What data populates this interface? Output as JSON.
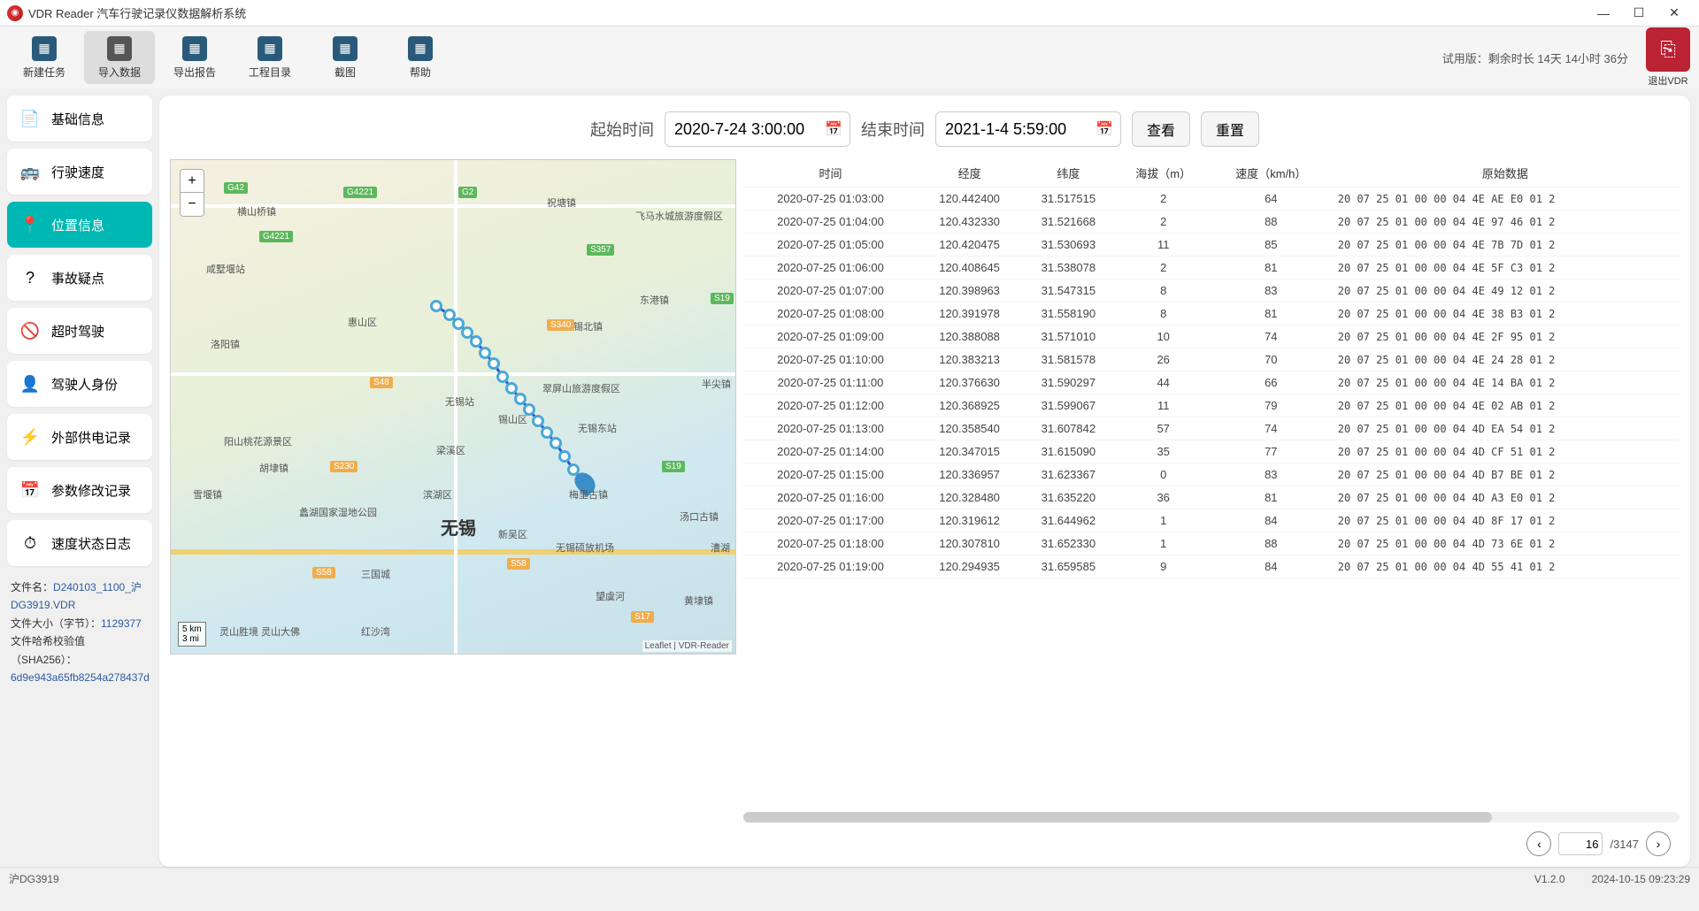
{
  "app": {
    "title": "VDR Reader 汽车行驶记录仪数据解析系统",
    "trial_text": "试用版：剩余时长 14天 14小时 36分",
    "exit_label": "退出VDR"
  },
  "toolbar": [
    {
      "id": "new-task",
      "label": "新建任务"
    },
    {
      "id": "import-data",
      "label": "导入数据",
      "active": true
    },
    {
      "id": "export-report",
      "label": "导出报告"
    },
    {
      "id": "project-dir",
      "label": "工程目录"
    },
    {
      "id": "screenshot",
      "label": "截图"
    },
    {
      "id": "help",
      "label": "帮助"
    }
  ],
  "sidebar": [
    {
      "id": "basic-info",
      "label": "基础信息",
      "icon": "📄"
    },
    {
      "id": "speed",
      "label": "行驶速度",
      "icon": "🚌"
    },
    {
      "id": "location",
      "label": "位置信息",
      "icon": "📍",
      "active": true
    },
    {
      "id": "accident",
      "label": "事故疑点",
      "icon": "?"
    },
    {
      "id": "overtime",
      "label": "超时驾驶",
      "icon": "🚫"
    },
    {
      "id": "driver",
      "label": "驾驶人身份",
      "icon": "👤"
    },
    {
      "id": "power",
      "label": "外部供电记录",
      "icon": "⚡"
    },
    {
      "id": "param",
      "label": "参数修改记录",
      "icon": "📅"
    },
    {
      "id": "speedlog",
      "label": "速度状态日志",
      "icon": "⏱"
    }
  ],
  "fileinfo": {
    "name_key": "文件名：",
    "name_val": "D240103_1100_沪DG3919.VDR",
    "size_key": "文件大小（字节）：",
    "size_val": "1129377",
    "hash_key": "文件哈希校验值（SHA256）：",
    "hash_val": "6d9e943a65fb8254a278437d"
  },
  "filter": {
    "start_label": "起始时间",
    "start_value": "2020-7-24 3:00:00",
    "end_label": "结束时间",
    "end_value": "2021-1-4 5:59:00",
    "view_btn": "查看",
    "reset_btn": "重置"
  },
  "map": {
    "city": "无锡",
    "labels": [
      "惠山区",
      "锡山区",
      "滨湖区",
      "新吴区",
      "梁溪区",
      "锡北镇",
      "东港镇",
      "祝塘镇",
      "横山桥镇",
      "咸墅堰站",
      "洛阳镇",
      "阳山桃花源景区",
      "胡埭镇",
      "雪堰镇",
      "蠡湖国家湿地公园",
      "三国城",
      "红沙湾",
      "灵山胜境 灵山大佛",
      "无锡站",
      "无锡东站",
      "无锡硕放机场",
      "翠屏山旅游度假区",
      "梅里古镇",
      "汤口古镇",
      "黄埭镇",
      "望虞河",
      "飞马水城旅游度假区",
      "半尖镇",
      "漕湖"
    ],
    "badges": [
      "G42",
      "G4221",
      "G4221",
      "G2",
      "S357",
      "S19",
      "S340",
      "S48",
      "S230",
      "S19",
      "S58",
      "S58",
      "S17"
    ],
    "scale_km": "5 km",
    "scale_mi": "3 mi",
    "attrib": "Leaflet | VDR-Reader"
  },
  "table": {
    "headers": [
      "时间",
      "经度",
      "纬度",
      "海拔（m）",
      "速度（km/h）",
      "原始数据"
    ],
    "rows": [
      [
        "2020-07-25 01:03:00",
        "120.442400",
        "31.517515",
        "2",
        "64",
        "20 07 25 01 00 00 04 4E AE E0 01 2"
      ],
      [
        "2020-07-25 01:04:00",
        "120.432330",
        "31.521668",
        "2",
        "88",
        "20 07 25 01 00 00 04 4E 97 46 01 2"
      ],
      [
        "2020-07-25 01:05:00",
        "120.420475",
        "31.530693",
        "11",
        "85",
        "20 07 25 01 00 00 04 4E 7B 7D 01 2"
      ],
      [
        "2020-07-25 01:06:00",
        "120.408645",
        "31.538078",
        "2",
        "81",
        "20 07 25 01 00 00 04 4E 5F C3 01 2"
      ],
      [
        "2020-07-25 01:07:00",
        "120.398963",
        "31.547315",
        "8",
        "83",
        "20 07 25 01 00 00 04 4E 49 12 01 2"
      ],
      [
        "2020-07-25 01:08:00",
        "120.391978",
        "31.558190",
        "8",
        "81",
        "20 07 25 01 00 00 04 4E 38 B3 01 2"
      ],
      [
        "2020-07-25 01:09:00",
        "120.388088",
        "31.571010",
        "10",
        "74",
        "20 07 25 01 00 00 04 4E 2F 95 01 2"
      ],
      [
        "2020-07-25 01:10:00",
        "120.383213",
        "31.581578",
        "26",
        "70",
        "20 07 25 01 00 00 04 4E 24 28 01 2"
      ],
      [
        "2020-07-25 01:11:00",
        "120.376630",
        "31.590297",
        "44",
        "66",
        "20 07 25 01 00 00 04 4E 14 BA 01 2"
      ],
      [
        "2020-07-25 01:12:00",
        "120.368925",
        "31.599067",
        "11",
        "79",
        "20 07 25 01 00 00 04 4E 02 AB 01 2"
      ],
      [
        "2020-07-25 01:13:00",
        "120.358540",
        "31.607842",
        "57",
        "74",
        "20 07 25 01 00 00 04 4D EA 54 01 2"
      ],
      [
        "2020-07-25 01:14:00",
        "120.347015",
        "31.615090",
        "35",
        "77",
        "20 07 25 01 00 00 04 4D CF 51 01 2"
      ],
      [
        "2020-07-25 01:15:00",
        "120.336957",
        "31.623367",
        "0",
        "83",
        "20 07 25 01 00 00 04 4D B7 BE 01 2"
      ],
      [
        "2020-07-25 01:16:00",
        "120.328480",
        "31.635220",
        "36",
        "81",
        "20 07 25 01 00 00 04 4D A3 E0 01 2"
      ],
      [
        "2020-07-25 01:17:00",
        "120.319612",
        "31.644962",
        "1",
        "84",
        "20 07 25 01 00 00 04 4D 8F 17 01 2"
      ],
      [
        "2020-07-25 01:18:00",
        "120.307810",
        "31.652330",
        "1",
        "88",
        "20 07 25 01 00 00 04 4D 73 6E 01 2"
      ],
      [
        "2020-07-25 01:19:00",
        "120.294935",
        "31.659585",
        "9",
        "84",
        "20 07 25 01 00 00 04 4D 55 41 01 2"
      ]
    ]
  },
  "pager": {
    "current": "16",
    "total": "/3147"
  },
  "statusbar": {
    "plate": "沪DG3919",
    "version": "V1.2.0",
    "datetime": "2024-10-15 09:23:29"
  }
}
